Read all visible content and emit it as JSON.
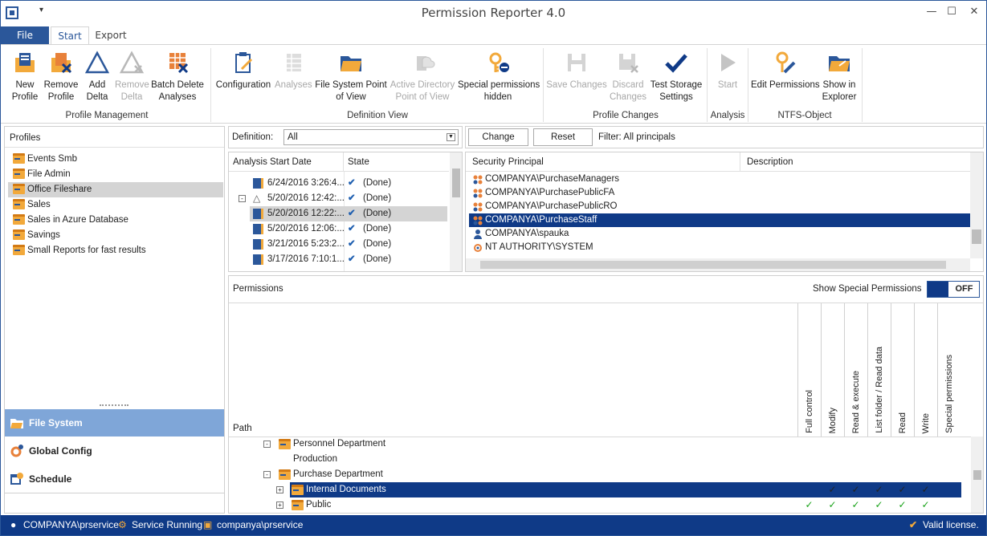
{
  "window": {
    "title": "Permission Reporter 4.0",
    "qat": "▾"
  },
  "ribbon": {
    "file_tab": "File",
    "tabs": [
      "Start",
      "Export"
    ],
    "groups": [
      "Profile Management",
      "Definition View",
      "Profile Changes",
      "Analysis",
      "NTFS-Object"
    ],
    "buttons": {
      "new_profile": "New\nProfile",
      "remove_profile": "Remove\nProfile",
      "add_delta": "Add\nDelta",
      "remove_delta": "Remove\nDelta",
      "batch_delete": "Batch Delete\nAnalyses",
      "configuration": "Configuration",
      "analyses": "Analyses",
      "fs_pov": "File System Point\nof View",
      "ad_pov": "Active Directory\nPoint of View",
      "special_hidden": "Special permissions\nhidden",
      "save_changes": "Save Changes",
      "discard_changes": "Discard\nChanges",
      "test_storage": "Test Storage\nSettings",
      "start": "Start",
      "edit_permissions": "Edit Permissions",
      "show_explorer": "Show in\nExplorer"
    }
  },
  "profiles": {
    "header": "Profiles",
    "items": [
      "Events Smb",
      "File Admin",
      "Office Fileshare",
      "Sales",
      "Sales in Azure Database",
      "Savings",
      "Small Reports for fast results"
    ],
    "selected_index": 2
  },
  "nav": {
    "file_system": "File System",
    "global_config": "Global Config",
    "schedule": "Schedule"
  },
  "definition": {
    "label": "Definition:",
    "value": "All"
  },
  "analyses": {
    "col_date": "Analysis Start Date",
    "col_state": "State",
    "rows": [
      {
        "date": "6/24/2016 3:26:4...",
        "state": "(Done)"
      },
      {
        "date": "5/20/2016 12:42:...",
        "state": "(Done)"
      },
      {
        "date": "5/20/2016 12:22:...",
        "state": "(Done)"
      },
      {
        "date": "5/20/2016 12:06:...",
        "state": "(Done)"
      },
      {
        "date": "3/21/2016 5:23:2...",
        "state": "(Done)"
      },
      {
        "date": "3/17/2016 7:10:1...",
        "state": "(Done)"
      }
    ]
  },
  "principals": {
    "change": "Change",
    "reset": "Reset",
    "filter": "Filter: All principals",
    "col_principal": "Security Principal",
    "col_desc": "Description",
    "rows": [
      "COMPANYA\\PurchaseManagers",
      "COMPANYA\\PurchasePublicFA",
      "COMPANYA\\PurchasePublicRO",
      "COMPANYA\\PurchaseStaff",
      "COMPANYA\\spauka",
      "NT AUTHORITY\\SYSTEM"
    ]
  },
  "permissions": {
    "header": "Permissions",
    "show_special": "Show Special Permissions",
    "toggle": "OFF",
    "path_col": "Path",
    "columns": [
      "Full control",
      "Modify",
      "Read & execute",
      "List folder / Read data",
      "Read",
      "Write",
      "Special permissions"
    ],
    "rows": [
      {
        "name": "Personnel Department"
      },
      {
        "name": "Production"
      },
      {
        "name": "Purchase Department"
      },
      {
        "name": "Internal Documents"
      },
      {
        "name": "Public"
      }
    ],
    "check_glyph": "✓"
  },
  "status": {
    "user": "COMPANYA\\prservice",
    "service": "Service Running",
    "machine": "companya\\prservice",
    "license": "Valid license."
  },
  "colors": {
    "accent": "#2b579a",
    "selection": "#0f3a87",
    "folder": "#f2a93b"
  }
}
